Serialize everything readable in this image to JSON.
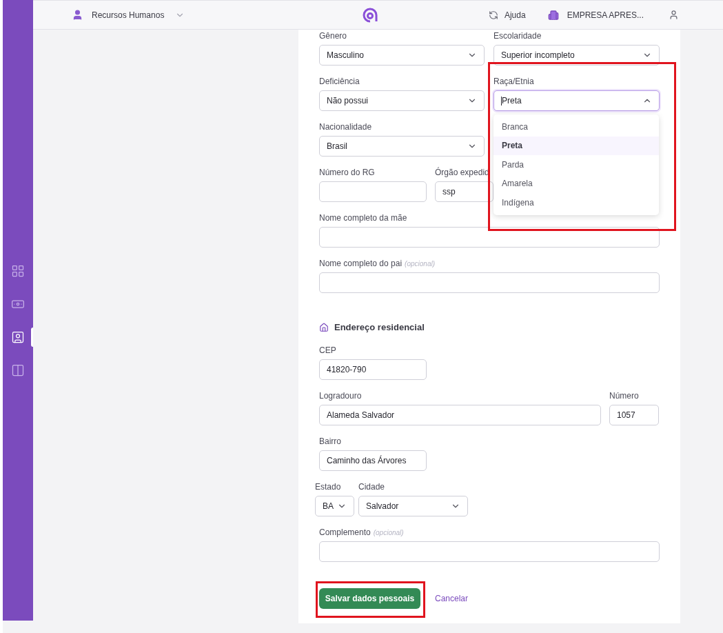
{
  "topbar": {
    "module": "Recursos Humanos",
    "help": "Ajuda",
    "company": "EMPRESA APRES..."
  },
  "sidebar": {
    "items": [
      {
        "selected": false
      },
      {
        "selected": false
      },
      {
        "selected": true
      },
      {
        "selected": false
      }
    ]
  },
  "personal": {
    "gender": {
      "label": "Gênero",
      "value": "Masculino"
    },
    "education": {
      "label": "Escolaridade",
      "value": "Superior incompleto"
    },
    "disability": {
      "label": "Deficiência",
      "value": "Não possui"
    },
    "race": {
      "label": "Raça/Etnia",
      "value": "Preta",
      "open": true,
      "highlighted": true,
      "options": [
        {
          "label": "Branca",
          "selected": false
        },
        {
          "label": "Preta",
          "selected": true
        },
        {
          "label": "Parda",
          "selected": false
        },
        {
          "label": "Amarela",
          "selected": false
        },
        {
          "label": "Indígena",
          "selected": false
        }
      ]
    },
    "nationality": {
      "label": "Nacionalidade",
      "value": "Brasil"
    },
    "rg": {
      "label": "Número do RG"
    },
    "issuer": {
      "label": "Órgão expedid",
      "value": "ssp"
    },
    "mother": {
      "label": "Nome completo da mãe"
    },
    "father": {
      "label": "Nome completo do pai",
      "optional": "(opcional)"
    }
  },
  "address": {
    "title": "Endereço residencial",
    "cep": {
      "label": "CEP",
      "value": "41820-790"
    },
    "street": {
      "label": "Logradouro",
      "value": "Alameda Salvador"
    },
    "number": {
      "label": "Número",
      "value": "1057"
    },
    "district": {
      "label": "Bairro",
      "value": "Caminho das Árvores"
    },
    "state": {
      "label": "Estado",
      "value": "BA"
    },
    "city": {
      "label": "Cidade",
      "value": "Salvador"
    },
    "complement": {
      "label": "Complemento",
      "optional": "(opcional)"
    }
  },
  "actions": {
    "save": {
      "label": "Salvar dados pessoais",
      "highlighted": true
    },
    "cancel": "Cancelar"
  }
}
